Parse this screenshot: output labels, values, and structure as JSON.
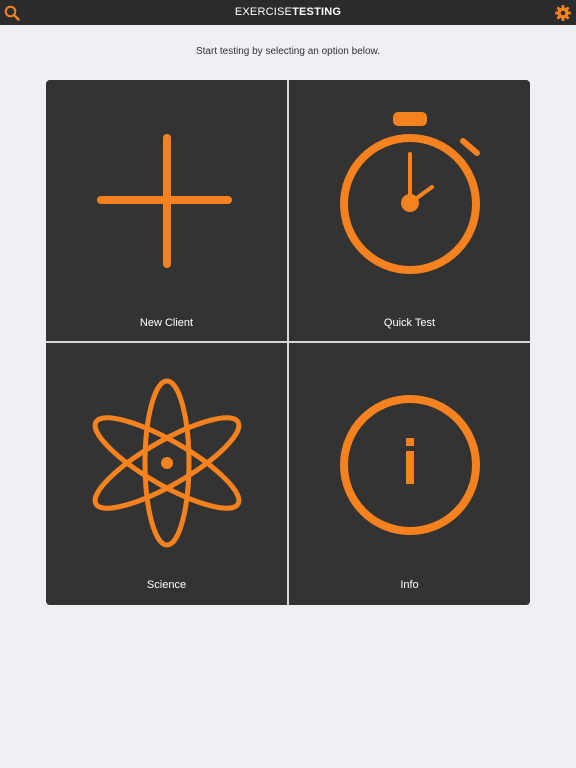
{
  "header": {
    "title_regular": "EXERCISE",
    "title_bold": "TESTING",
    "left_icon": "search-icon",
    "right_icon": "gear-icon"
  },
  "instructions": "Start testing by selecting an option below.",
  "tiles": [
    {
      "label": "New Client",
      "icon": "plus-icon"
    },
    {
      "label": "Quick Test",
      "icon": "stopwatch-icon"
    },
    {
      "label": "Science",
      "icon": "atom-icon"
    },
    {
      "label": "Info",
      "icon": "info-icon"
    }
  ],
  "colors": {
    "accent": "#f5821f",
    "tile_background": "#333333",
    "page_background": "#efeff4",
    "header_background": "#2b2b2b"
  }
}
